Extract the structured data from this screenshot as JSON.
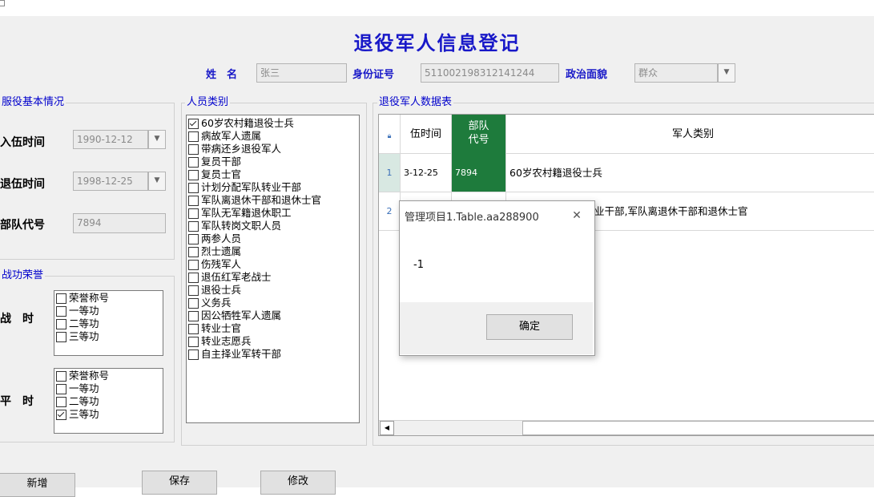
{
  "form": {
    "title": "退役军人信息登记",
    "name_label": "姓　名",
    "name_value": "张三",
    "id_label": "身份证号",
    "id_value": "511002198312141244",
    "politics_label": "政治面貌",
    "politics_value": "群众"
  },
  "service": {
    "group_title": "服役基本情况",
    "enlist_label": "入伍时间",
    "enlist_value": "1990-12-12",
    "discharge_label": "退伍时间",
    "discharge_value": "1998-12-25",
    "unit_label": "部队代号",
    "unit_value": "7894"
  },
  "honors": {
    "group_title": "战功荣誉",
    "wartime_label": "战　时",
    "peacetime_label": "平　时",
    "wartime": [
      {
        "label": "荣誉称号",
        "checked": false
      },
      {
        "label": "一等功",
        "checked": false
      },
      {
        "label": "二等功",
        "checked": false
      },
      {
        "label": "三等功",
        "checked": false
      }
    ],
    "peacetime": [
      {
        "label": "荣誉称号",
        "checked": false
      },
      {
        "label": "一等功",
        "checked": false
      },
      {
        "label": "二等功",
        "checked": false
      },
      {
        "label": "三等功",
        "checked": true
      }
    ]
  },
  "categories": {
    "group_title": "人员类别",
    "items": [
      {
        "label": "60岁农村籍退役士兵",
        "checked": true
      },
      {
        "label": "病故军人遗属",
        "checked": false
      },
      {
        "label": "带病还乡退役军人",
        "checked": false
      },
      {
        "label": "复员干部",
        "checked": false
      },
      {
        "label": "复员士官",
        "checked": false
      },
      {
        "label": "计划分配军队转业干部",
        "checked": false
      },
      {
        "label": "军队离退休干部和退休士官",
        "checked": false
      },
      {
        "label": "军队无军籍退休职工",
        "checked": false
      },
      {
        "label": "军队转岗文职人员",
        "checked": false
      },
      {
        "label": "两参人员",
        "checked": false
      },
      {
        "label": "烈士遗属",
        "checked": false
      },
      {
        "label": "伤残军人",
        "checked": false
      },
      {
        "label": "退伍红军老战士",
        "checked": false
      },
      {
        "label": "退役士兵",
        "checked": false
      },
      {
        "label": "义务兵",
        "checked": false
      },
      {
        "label": "因公牺牲军人遗属",
        "checked": false
      },
      {
        "label": "转业士官",
        "checked": false
      },
      {
        "label": "转业志愿兵",
        "checked": false
      },
      {
        "label": "自主择业军转干部",
        "checked": false
      }
    ]
  },
  "table": {
    "group_title": "退役军人数据表",
    "columns": [
      "伍时间",
      "部队代号",
      "军人类别"
    ],
    "rows": [
      {
        "num": "1",
        "date": "3-12-25",
        "unit": "7894",
        "category": "60岁农村籍退役士兵"
      },
      {
        "num": "2",
        "date": "",
        "unit": "",
        "category": "业干部,军队离退休干部和退休士官"
      }
    ]
  },
  "dialog": {
    "title": "管理项目1.Table.aa288900",
    "message": "-1",
    "ok_label": "确定"
  },
  "buttons": {
    "add": "新增",
    "save": "保存",
    "edit": "修改"
  },
  "colors": {
    "accent_blue": "#1818c8",
    "selected_cell": "#1e7b3c"
  }
}
